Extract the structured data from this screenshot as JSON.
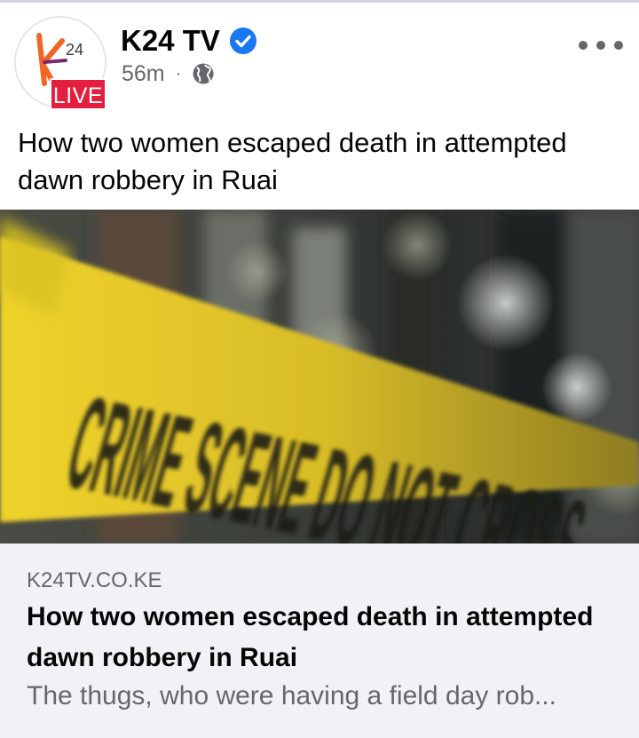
{
  "post": {
    "page_name": "K24 TV",
    "verified_icon": "verified-badge-icon",
    "time": "56m",
    "separator": "·",
    "audience_icon": "globe-icon",
    "live_badge": "LIVE",
    "logo_text": "24",
    "caption": "How two women escaped death in attempted dawn robbery in Ruai",
    "more_icon": "more-options-icon"
  },
  "image": {
    "alt_subject": "crime-scene-tape",
    "tape_text": "CRIME SCENE DO NOT CROSS"
  },
  "link_preview": {
    "domain": "K24TV.CO.KE",
    "title": "How two women escaped death in attempted dawn robbery in Ruai",
    "description": "The thugs, who were having a field day rob..."
  },
  "colors": {
    "verified_blue": "#1877f2",
    "live_red": "#e41e3f",
    "logo_orange": "#f26522",
    "tape_yellow": "#e6c724",
    "secondary_text": "#65676b",
    "card_bg": "#f0f2f5"
  }
}
